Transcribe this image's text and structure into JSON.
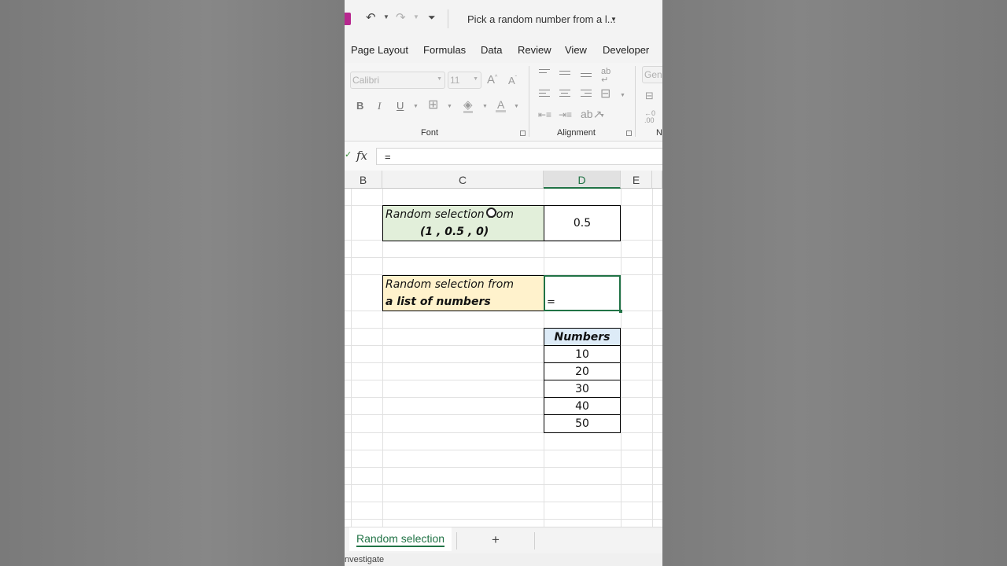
{
  "title_bar": {
    "document_title": "Pick a random number from a l...",
    "undo_icon": "undo-icon",
    "redo_icon": "redo-icon",
    "customize_icon": "customize-quick-access-icon"
  },
  "menu_tabs": [
    "Page Layout",
    "Formulas",
    "Data",
    "Review",
    "View",
    "Developer"
  ],
  "ribbon": {
    "font_name": "Calibri",
    "font_size": "11",
    "number_format": "Gene",
    "bold": "B",
    "italic": "I",
    "underline": "U",
    "font_color": "A",
    "group_font": "Font",
    "group_alignment": "Alignment",
    "group_number": "N"
  },
  "formula_bar": {
    "fx": "fx",
    "content": "="
  },
  "columns": [
    "B",
    "C",
    "D",
    "E"
  ],
  "selected_column": "D",
  "cells": {
    "c1_line1": "Random selection from",
    "c1_line2": "(1 ,  0.5 ,  0)",
    "d1_value": "0.5",
    "c2_line1": "Random selection from",
    "c2_line2": "a list of numbers",
    "d2_value": "=",
    "numbers_header": "Numbers",
    "numbers": [
      "10",
      "20",
      "30",
      "40",
      "50"
    ]
  },
  "sheet_tabs": {
    "active": "Random selection",
    "add": "+"
  },
  "status_bar": {
    "text": "nvestigate"
  },
  "colors": {
    "accent": "#217346",
    "green_fill": "#e2efda",
    "yellow_fill": "#fff2cc",
    "blue_fill": "#ddebf7"
  }
}
